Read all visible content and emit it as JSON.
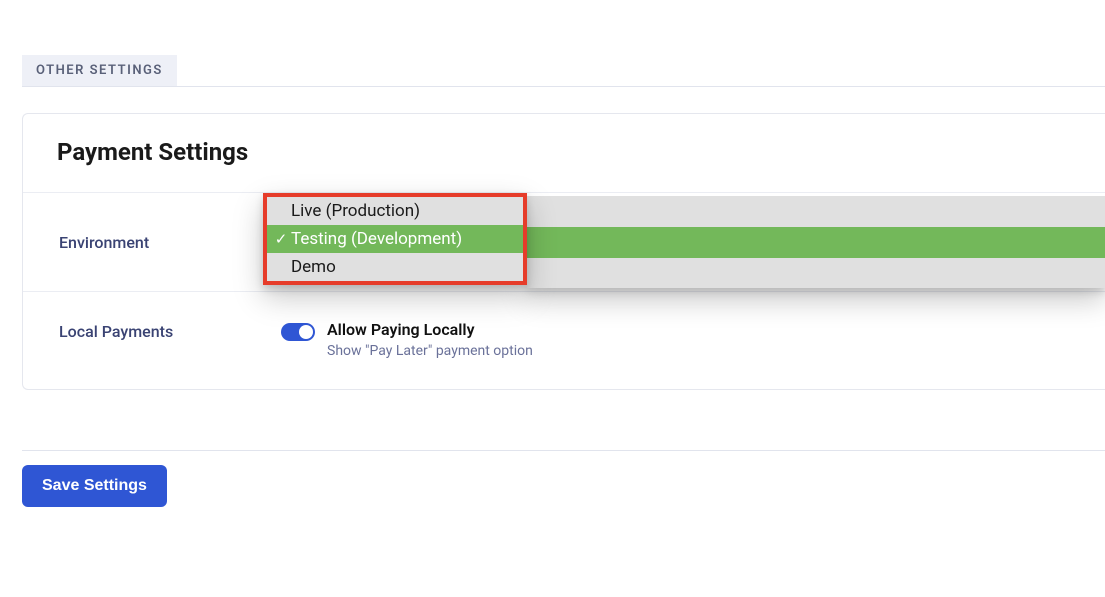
{
  "section_tab": "OTHER SETTINGS",
  "panel": {
    "title": "Payment Settings"
  },
  "environment": {
    "label": "Environment",
    "options": [
      "Live (Production)",
      "Testing (Development)",
      "Demo"
    ],
    "selected_index": 1
  },
  "local_payments": {
    "label": "Local Payments",
    "toggle_on": true,
    "title": "Allow Paying Locally",
    "subtitle": "Show \"Pay Later\" payment option"
  },
  "save_button": "Save Settings"
}
